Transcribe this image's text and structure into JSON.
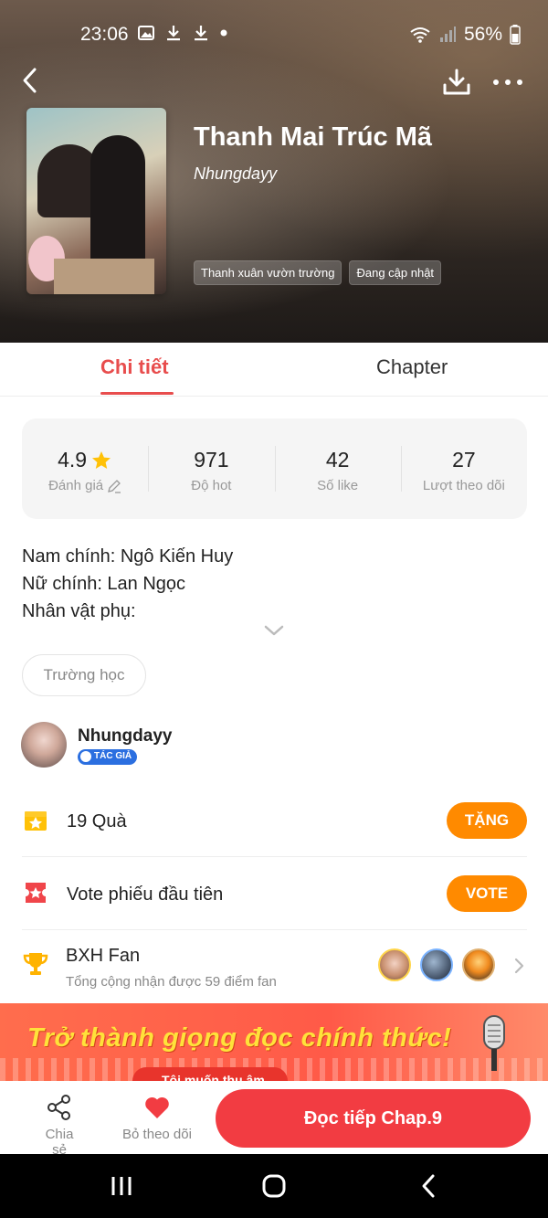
{
  "status_bar": {
    "time": "23:06",
    "battery": "56%"
  },
  "book": {
    "title": "Thanh Mai Trúc Mã",
    "author": "Nhungdayy",
    "tags": [
      "Thanh xuân vườn trường",
      "Đang cập nhật"
    ]
  },
  "tabs": {
    "detail": "Chi tiết",
    "chapter": "Chapter"
  },
  "stats": {
    "rating_value": "4.9",
    "rating_label": "Đánh giá",
    "hot_value": "971",
    "hot_label": "Độ hot",
    "likes_value": "42",
    "likes_label": "Số like",
    "followers_value": "27",
    "followers_label": "Lượt theo dõi"
  },
  "description": {
    "line1": "Nam chính: Ngô Kiến Huy",
    "line2": "Nữ chính: Lan Ngọc",
    "line3": "Nhân vật phụ:"
  },
  "genre_chip": "Trường học",
  "author_block": {
    "name": "Nhungdayy",
    "badge": "TÁC GIẢ"
  },
  "gift_row": {
    "text": "19 Quà",
    "button": "TẶNG"
  },
  "vote_row": {
    "text": "Vote phiếu đầu tiên",
    "button": "VOTE"
  },
  "fan_rank": {
    "title": "BXH Fan",
    "subtitle": "Tổng cộng nhận được 59 điểm fan"
  },
  "banner": {
    "headline": "Trở thành giọng đọc chính thức!",
    "cta": "Tôi muốn thu âm"
  },
  "bottom_bar": {
    "share": "Chia sẻ",
    "unfollow": "Bỏ theo dõi",
    "read": "Đọc tiếp Chap.9"
  },
  "colors": {
    "accent": "#e84d4d",
    "orange": "#ff8a00",
    "read_button": "#f23c42",
    "banner_text": "#ffe23a"
  },
  "icons": [
    "image-icon",
    "download-icon",
    "wifi-icon",
    "signal-icon",
    "battery-icon",
    "back-icon",
    "more-icon",
    "star-icon",
    "edit-icon",
    "chevron-down-icon",
    "gift-icon",
    "ticket-icon",
    "trophy-icon",
    "chevron-right-icon",
    "share-icon",
    "heart-icon",
    "mic-icon"
  ]
}
